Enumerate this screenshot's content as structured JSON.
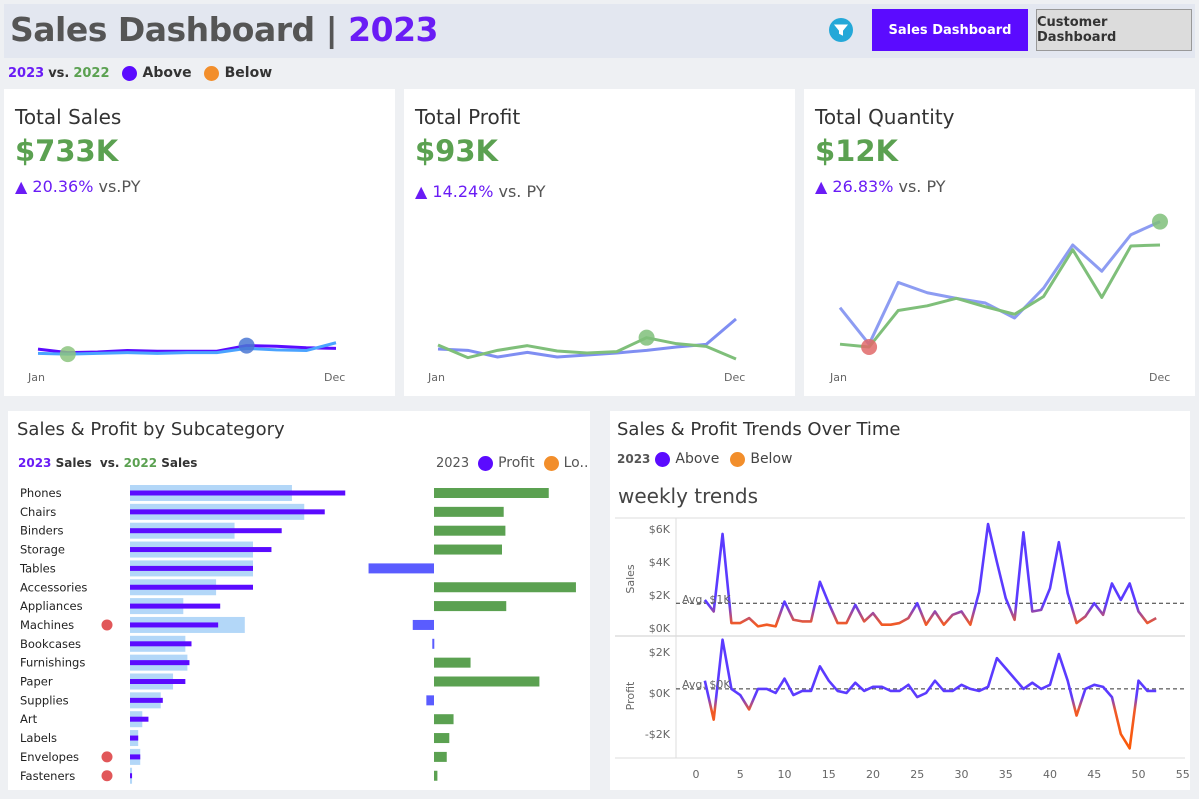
{
  "header": {
    "title_main": "Sales Dashboard |",
    "title_year": "2023",
    "filter_icon": "filter-icon",
    "btn_sales": "Sales Dashboard",
    "btn_customer": "Customer Dashboard"
  },
  "legend": {
    "cur_year": "2023",
    "vs": "vs.",
    "prev_year": "2022",
    "above": "Above",
    "below": "Below",
    "above_color": "#5b0bff",
    "below_color": "#f28e2b"
  },
  "kpis": [
    {
      "title": "Total Sales",
      "value": "$733K",
      "delta": "▲ 20.36%",
      "suffix": "vs.PY"
    },
    {
      "title": "Total Profit",
      "value": "$93K",
      "delta": "▲ 14.24%",
      "suffix": "vs. PY"
    },
    {
      "title": "Total Quantity",
      "value": "$12K",
      "delta": "▲ 26.83%",
      "suffix": "vs. PY"
    }
  ],
  "subcategory": {
    "title": "Sales & Profit by Subcategory",
    "legend_cur": "2023",
    "legend_sales": "Sales",
    "legend_vs": "vs.",
    "legend_prev": "2022",
    "legend_sales2": "Sales",
    "profit_legend_year": "2023",
    "profit_legend_profit": "Profit",
    "profit_legend_loss": "Lo.."
  },
  "trends": {
    "title": "Sales & Profit Trends Over Time",
    "legend_year": "2023",
    "above": "Above",
    "below": "Below",
    "subtitle": "weekly trends",
    "sales_axis": "Sales",
    "profit_axis": "Profit",
    "sales_avg": "Avg. $1K",
    "profit_avg": "Avg. $0K"
  },
  "chart_data": [
    {
      "type": "line",
      "chart": "total-sales-sparkline",
      "x_labels": [
        "Jan",
        "Dec"
      ],
      "series": [
        {
          "values": [
            2.1,
            1.6,
            1.7,
            1.9,
            1.8,
            1.8,
            1.8,
            2.6,
            2.5,
            2.3,
            2.2
          ],
          "color": "#5b0bff"
        },
        {
          "values": [
            1.5,
            1.4,
            1.5,
            1.6,
            1.5,
            1.6,
            1.6,
            2.2,
            2.0,
            1.9,
            3.0
          ],
          "color": "#4aa3ff"
        }
      ],
      "ylim": [
        0,
        12
      ]
    },
    {
      "type": "line",
      "chart": "total-profit-sparkline",
      "x_labels": [
        "Jan",
        "Dec"
      ],
      "series": [
        {
          "values": [
            1.5,
            1.3,
            0.3,
            1.0,
            0.3,
            0.6,
            0.9,
            1.3,
            1.8,
            2.2,
            6.0
          ],
          "color": "#7f8ef2"
        },
        {
          "values": [
            2.1,
            0.2,
            1.3,
            2.0,
            1.2,
            0.9,
            1.1,
            3.2,
            2.3,
            1.9,
            0.0
          ],
          "color": "#7fbf7a"
        }
      ],
      "ylim": [
        0,
        12
      ]
    },
    {
      "type": "line",
      "chart": "total-quantity-sparkline",
      "x_labels": [
        "Jan",
        "Dec"
      ],
      "series": [
        {
          "values": [
            4.2,
            0.3,
            6.9,
            5.8,
            5.2,
            4.7,
            3.1,
            6.3,
            10.9,
            8.1,
            12.0,
            13.4
          ],
          "color": "#8d9cf2"
        },
        {
          "values": [
            0.3,
            0.0,
            3.9,
            4.4,
            5.2,
            4.3,
            3.5,
            5.4,
            10.4,
            5.3,
            10.8,
            10.9
          ],
          "color": "#7fbf7a"
        }
      ],
      "ylim": [
        0,
        14
      ]
    },
    {
      "type": "bar",
      "chart": "sales-by-subcategory",
      "categories": [
        "Phones",
        "Chairs",
        "Binders",
        "Storage",
        "Tables",
        "Accessories",
        "Appliances",
        "Machines",
        "Bookcases",
        "Furnishings",
        "Paper",
        "Supplies",
        "Art",
        "Labels",
        "Envelopes",
        "Fasteners"
      ],
      "series": [
        {
          "name": "2023",
          "values": [
            105,
            95,
            74,
            69,
            60,
            60,
            44,
            43,
            30,
            29,
            27,
            16,
            9,
            4,
            5,
            1
          ],
          "color": "#5b0bff"
        },
        {
          "name": "2022",
          "values": [
            79,
            85,
            51,
            60,
            60,
            42,
            26,
            56,
            27,
            28,
            21,
            15,
            6,
            4,
            5,
            1
          ],
          "color": "#b3d7f8"
        }
      ],
      "flagged_below": [
        "Machines",
        "Envelopes",
        "Fasteners"
      ],
      "flag_color": "#e15759"
    },
    {
      "type": "bar",
      "chart": "profit-by-subcategory",
      "categories": [
        "Phones",
        "Chairs",
        "Binders",
        "Storage",
        "Tables",
        "Accessories",
        "Appliances",
        "Machines",
        "Bookcases",
        "Furnishings",
        "Paper",
        "Supplies",
        "Art",
        "Labels",
        "Envelopes",
        "Fasteners"
      ],
      "values": [
        13.5,
        8.2,
        8.4,
        8.0,
        -7.7,
        16.7,
        8.5,
        -2.5,
        -0.2,
        4.3,
        12.4,
        -0.9,
        2.3,
        1.8,
        1.5,
        0.4
      ],
      "positive_color": "#5ba151",
      "negative_color": "#5a5cff"
    },
    {
      "type": "line",
      "chart": "weekly-sales",
      "x": [
        1,
        2,
        3,
        4,
        5,
        6,
        7,
        8,
        9,
        10,
        11,
        12,
        13,
        14,
        15,
        16,
        17,
        18,
        19,
        20,
        21,
        22,
        23,
        24,
        25,
        26,
        27,
        28,
        29,
        30,
        31,
        32,
        33,
        34,
        35,
        36,
        37,
        38,
        39,
        40,
        41,
        42,
        43,
        44,
        45,
        46,
        47,
        48,
        49,
        50,
        51,
        52
      ],
      "values": [
        1.7,
        1.0,
        5.7,
        0.3,
        0.3,
        0.6,
        0.1,
        0.2,
        0.1,
        1.6,
        0.5,
        0.4,
        0.4,
        2.8,
        1.5,
        0.3,
        0.3,
        1.4,
        0.4,
        0.9,
        0.2,
        0.2,
        0.3,
        0.6,
        1.5,
        0.2,
        1.0,
        0.2,
        0.8,
        1.0,
        0.2,
        2.2,
        6.3,
        4.0,
        1.8,
        0.5,
        5.8,
        1.0,
        1.1,
        2.4,
        5.2,
        2.1,
        0.3,
        0.7,
        1.5,
        0.8,
        2.7,
        1.7,
        2.7,
        1.0,
        0.3,
        0.6
      ],
      "avg": 1.5,
      "ylim": [
        0,
        6.5
      ],
      "y_ticks": [
        "$0K",
        "$2K",
        "$4K",
        "$6K"
      ]
    },
    {
      "type": "line",
      "chart": "weekly-profit",
      "x": [
        1,
        2,
        3,
        4,
        5,
        6,
        7,
        8,
        9,
        10,
        11,
        12,
        13,
        14,
        15,
        16,
        17,
        18,
        19,
        20,
        21,
        22,
        23,
        24,
        25,
        26,
        27,
        28,
        29,
        30,
        31,
        32,
        33,
        34,
        35,
        36,
        37,
        38,
        39,
        40,
        41,
        42,
        43,
        44,
        45,
        46,
        47,
        48,
        49,
        50,
        51,
        52
      ],
      "values": [
        0.6,
        -1.3,
        2.6,
        0.2,
        -0.1,
        -0.8,
        0.2,
        0.2,
        0.0,
        0.7,
        -0.1,
        0.1,
        0.1,
        1.3,
        0.6,
        0.1,
        0.0,
        0.5,
        0.1,
        0.3,
        0.3,
        0.1,
        0.1,
        0.4,
        -0.2,
        0.0,
        0.6,
        0.1,
        0.1,
        0.4,
        0.2,
        0.1,
        0.3,
        1.7,
        1.2,
        0.7,
        0.2,
        0.5,
        0.2,
        0.4,
        1.9,
        0.6,
        -1.1,
        0.2,
        0.4,
        0.3,
        -0.2,
        -2.0,
        -2.7,
        0.6,
        0.1,
        0.1
      ],
      "avg": 0.2,
      "ylim": [
        -3,
        2.5
      ],
      "y_ticks": [
        "-$2K",
        "$0K",
        "$2K"
      ],
      "x_ticks": [
        "0",
        "5",
        "10",
        "15",
        "20",
        "25",
        "30",
        "35",
        "40",
        "45",
        "50",
        "55"
      ]
    }
  ]
}
